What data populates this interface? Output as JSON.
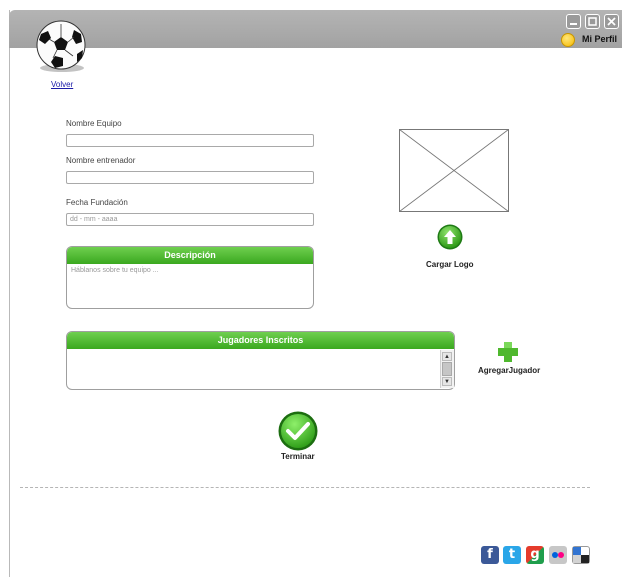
{
  "header": {
    "profile_label": "Mi Perfil"
  },
  "nav": {
    "back_label": "Volver"
  },
  "form": {
    "team_name_label": "Nombre Equipo",
    "team_name_value": "",
    "coach_label": "Nombre entrenador",
    "coach_value": "",
    "founded_label": "Fecha Fundación",
    "founded_placeholder": "dd - mm - aaaa"
  },
  "description": {
    "title": "Descripción",
    "placeholder": "Háblanos sobre tu equipo ..."
  },
  "logo": {
    "upload_label": "Cargar Logo"
  },
  "players": {
    "title": "Jugadores Inscritos",
    "add_label": "AgregarJugador"
  },
  "finish": {
    "label": "Terminar"
  },
  "colors": {
    "accent_green": "#3aa81f",
    "titlebar_gray": "#a8a8a8",
    "link_blue": "#1a1aa8"
  },
  "social_icons": [
    "facebook-icon",
    "twitter-icon",
    "google-icon",
    "flickr-icon",
    "delicious-icon"
  ]
}
